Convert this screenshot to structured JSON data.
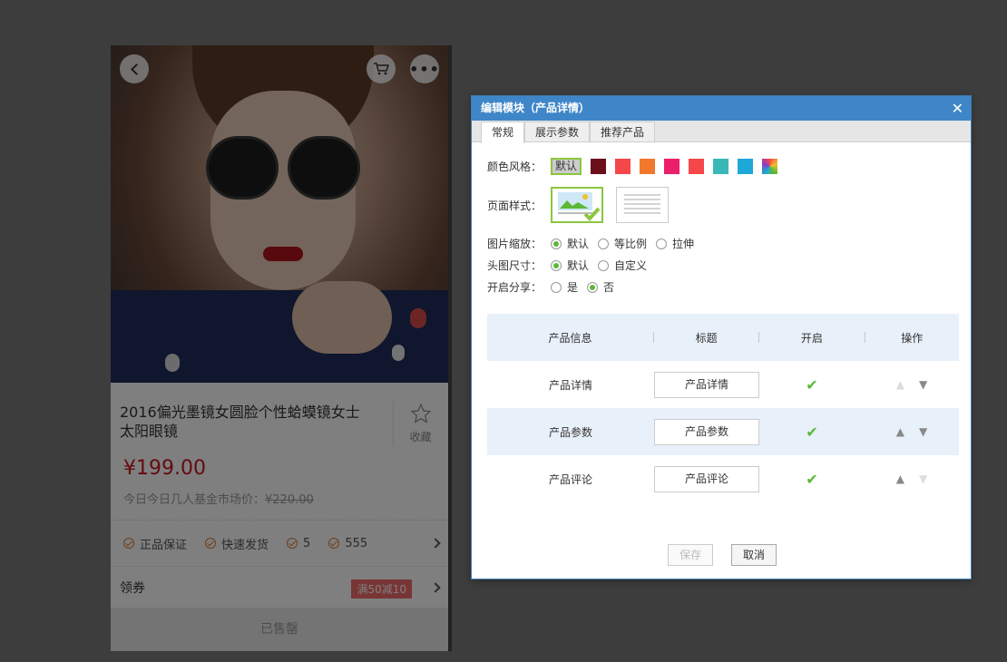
{
  "phone": {
    "product_title": "2016偏光墨镜女圆脸个性蛤蟆镜女士太阳眼镜",
    "fav_label": "收藏",
    "price": "¥199.00",
    "market_prefix": "今日今日几人基金市场价：",
    "market_price": "¥220.00",
    "guarantees": [
      "正品保证",
      "快速发货",
      "5",
      "555"
    ],
    "coupon_label": "领券",
    "coupon_tag": "满50减10",
    "sold_label": "已售罄"
  },
  "dialog": {
    "title": "编辑模块（产品详情）",
    "close_icon": "close-icon",
    "tabs": [
      "常规",
      "展示参数",
      "推荐产品"
    ],
    "color_style_label": "颜色风格：",
    "color_default": "默认",
    "colors": [
      "#6b0f1a",
      "#f5474a",
      "#f2782b",
      "#eb1f6a",
      "#f5474a",
      "#39b8b6",
      "#1ea8d8"
    ],
    "page_style_label": "页面样式：",
    "image_scale_label": "图片缩放：",
    "image_scale_options": [
      "默认",
      "等比例",
      "拉伸"
    ],
    "header_size_label": "头图尺寸：",
    "header_size_options": [
      "默认",
      "自定义"
    ],
    "share_label": "开启分享：",
    "share_options": [
      "是",
      "否"
    ],
    "table": {
      "headers": [
        "产品信息",
        "标题",
        "开启",
        "操作"
      ],
      "rows": [
        {
          "info": "产品详情",
          "title": "产品详情"
        },
        {
          "info": "产品参数",
          "title": "产品参数"
        },
        {
          "info": "产品评论",
          "title": "产品评论"
        }
      ]
    },
    "save_label": "保存",
    "cancel_label": "取消",
    "accent": "#3f86c8",
    "selected_green": "#8cc63f"
  }
}
